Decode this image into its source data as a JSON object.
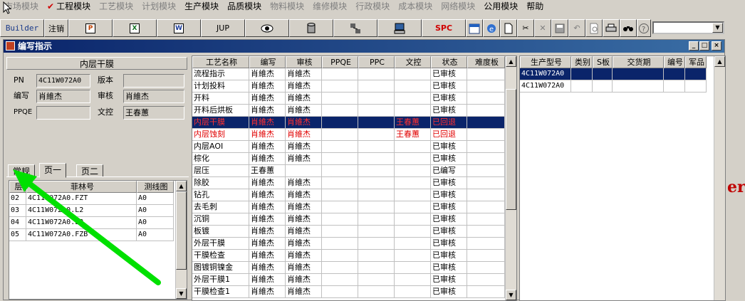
{
  "menu": [
    {
      "label": "市场模块",
      "disabled": true,
      "checked": false
    },
    {
      "label": "工程模块",
      "disabled": false,
      "checked": true
    },
    {
      "label": "工艺模块",
      "disabled": true,
      "checked": false
    },
    {
      "label": "计划模块",
      "disabled": true,
      "checked": false
    },
    {
      "label": "生产模块",
      "disabled": false,
      "checked": false
    },
    {
      "label": "品质模块",
      "disabled": false,
      "checked": false
    },
    {
      "label": "物料模块",
      "disabled": true,
      "checked": false
    },
    {
      "label": "维修模块",
      "disabled": true,
      "checked": false
    },
    {
      "label": "行政模块",
      "disabled": true,
      "checked": false
    },
    {
      "label": "成本模块",
      "disabled": true,
      "checked": false
    },
    {
      "label": "网络模块",
      "disabled": true,
      "checked": false
    },
    {
      "label": "公用模块",
      "disabled": false,
      "checked": false
    },
    {
      "label": "帮助",
      "disabled": false,
      "checked": false
    }
  ],
  "toolbar": {
    "builder_label": "Builder",
    "logout_label": "注销",
    "jup_label": "JUP",
    "spc_label": "SPC",
    "icons": [
      "ppt-icon",
      "excel-icon",
      "word-icon",
      "jup-button",
      "eye-icon",
      "database-icon",
      "network-icon",
      "computer-icon",
      "spc-button",
      "calendar-icon",
      "ie-icon",
      "new-file-icon",
      "cut-icon",
      "delete-icon",
      "save-icon",
      "undo-icon",
      "preview-icon",
      "print-icon",
      "find-icon",
      "help-icon"
    ]
  },
  "window": {
    "title": "编写指示",
    "controls": {
      "minimize": "_",
      "restore": "□",
      "close": "×"
    }
  },
  "left": {
    "header": "内层干膜",
    "fields": {
      "pn_label": "PN",
      "pn_value": "4C11W072A0",
      "version_label": "版本",
      "version_value": "",
      "author_label": "编写",
      "author_value": "肖維杰",
      "review_label": "审核",
      "review_value": "肖維杰",
      "ppqe_label": "PPQE",
      "ppqe_value": "",
      "dc_label": "文控",
      "dc_value": "王春蕙"
    },
    "tabs": [
      "常规",
      "页一",
      "页二"
    ],
    "active_tab": 1,
    "layer_table": {
      "columns": [
        "层",
        "菲林号",
        "测线图"
      ],
      "rows": [
        [
          "02",
          "4C11W072A0.FZT",
          "A0"
        ],
        [
          "03",
          "4C11W072A0.L2",
          "A0"
        ],
        [
          "04",
          "4C11W072A0.L3",
          "A0"
        ],
        [
          "05",
          "4C11W072A0.FZB",
          "A0"
        ]
      ]
    }
  },
  "process_table": {
    "columns": [
      "工艺名称",
      "编写",
      "审核",
      "PPQE",
      "PPC",
      "文控",
      "状态",
      "难度板"
    ],
    "rows": [
      {
        "cells": [
          "流程指示",
          "肖維杰",
          "肖維杰",
          "",
          "",
          "",
          "已审核",
          ""
        ],
        "selected": false,
        "alert": false
      },
      {
        "cells": [
          "计划投料",
          "肖維杰",
          "肖維杰",
          "",
          "",
          "",
          "已审核",
          ""
        ],
        "selected": false,
        "alert": false
      },
      {
        "cells": [
          "开料",
          "肖維杰",
          "肖維杰",
          "",
          "",
          "",
          "已审核",
          ""
        ],
        "selected": false,
        "alert": false
      },
      {
        "cells": [
          "开料后烘板",
          "肖維杰",
          "肖維杰",
          "",
          "",
          "",
          "已审核",
          ""
        ],
        "selected": false,
        "alert": false
      },
      {
        "cells": [
          "内层干膜",
          "肖維杰",
          "肖維杰",
          "",
          "",
          "王春蕙",
          "已回退",
          ""
        ],
        "selected": true,
        "alert": true
      },
      {
        "cells": [
          "内层蚀刻",
          "肖維杰",
          "肖維杰",
          "",
          "",
          "王春蕙",
          "已回退",
          ""
        ],
        "selected": false,
        "alert": true
      },
      {
        "cells": [
          "内层AOI",
          "肖維杰",
          "肖維杰",
          "",
          "",
          "",
          "已审核",
          ""
        ],
        "selected": false,
        "alert": false
      },
      {
        "cells": [
          "棕化",
          "肖維杰",
          "肖維杰",
          "",
          "",
          "",
          "已审核",
          ""
        ],
        "selected": false,
        "alert": false
      },
      {
        "cells": [
          "层压",
          "王春蕙",
          "",
          "",
          "",
          "",
          "已编写",
          ""
        ],
        "selected": false,
        "alert": false
      },
      {
        "cells": [
          "除胶",
          "肖維杰",
          "肖維杰",
          "",
          "",
          "",
          "已审核",
          ""
        ],
        "selected": false,
        "alert": false
      },
      {
        "cells": [
          "钻孔",
          "肖維杰",
          "肖維杰",
          "",
          "",
          "",
          "已审核",
          ""
        ],
        "selected": false,
        "alert": false
      },
      {
        "cells": [
          "去毛刺",
          "肖維杰",
          "肖維杰",
          "",
          "",
          "",
          "已审核",
          ""
        ],
        "selected": false,
        "alert": false
      },
      {
        "cells": [
          "沉铜",
          "肖維杰",
          "肖維杰",
          "",
          "",
          "",
          "已审核",
          ""
        ],
        "selected": false,
        "alert": false
      },
      {
        "cells": [
          "板镀",
          "肖維杰",
          "肖維杰",
          "",
          "",
          "",
          "已审核",
          ""
        ],
        "selected": false,
        "alert": false
      },
      {
        "cells": [
          "外层干膜",
          "肖維杰",
          "肖維杰",
          "",
          "",
          "",
          "已审核",
          ""
        ],
        "selected": false,
        "alert": false
      },
      {
        "cells": [
          "干膜检查",
          "肖維杰",
          "肖維杰",
          "",
          "",
          "",
          "已审核",
          ""
        ],
        "selected": false,
        "alert": false
      },
      {
        "cells": [
          "图镀铜镍金",
          "肖維杰",
          "肖維杰",
          "",
          "",
          "",
          "已审核",
          ""
        ],
        "selected": false,
        "alert": false
      },
      {
        "cells": [
          "外层干膜1",
          "肖維杰",
          "肖維杰",
          "",
          "",
          "",
          "已审核",
          ""
        ],
        "selected": false,
        "alert": false
      },
      {
        "cells": [
          "干膜检查1",
          "肖維杰",
          "肖維杰",
          "",
          "",
          "",
          "已审核",
          ""
        ],
        "selected": false,
        "alert": false
      }
    ]
  },
  "model_table": {
    "columns": [
      "生产型号",
      "类别",
      "S板",
      "交货期",
      "编号",
      "军品"
    ],
    "rows": [
      {
        "cells": [
          "4C11W072A0",
          "",
          "",
          "",
          "",
          ""
        ],
        "selected": true
      },
      {
        "cells": [
          "4C11W072A0",
          "",
          "",
          "",
          "",
          ""
        ],
        "selected": false
      }
    ]
  },
  "background_text": "er",
  "colors": {
    "accent": "#0a246a",
    "alert": "#e00000",
    "annotation": "#00e000"
  }
}
